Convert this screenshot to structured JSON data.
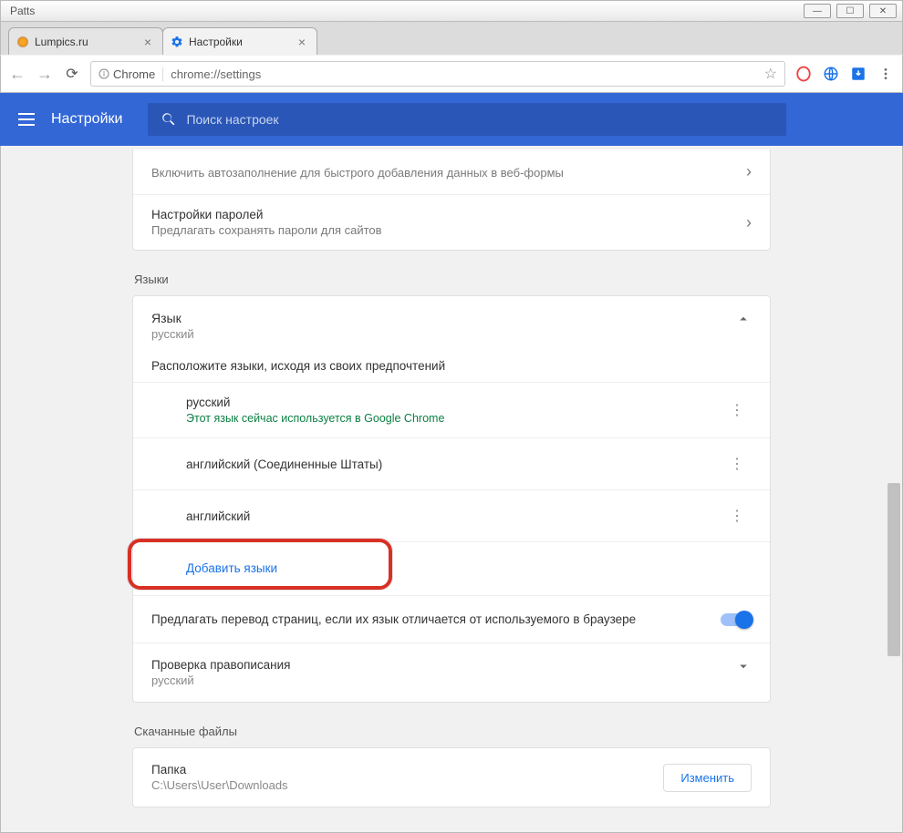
{
  "titlebar": {
    "app": "Patts"
  },
  "tabs": [
    {
      "label": "Lumpics.ru"
    },
    {
      "label": "Настройки"
    }
  ],
  "omnibox": {
    "origin": "Chrome",
    "url": "chrome://settings"
  },
  "header": {
    "title": "Настройки",
    "search_placeholder": "Поиск настроек"
  },
  "top_card": {
    "autofill_sub": "Включить автозаполнение для быстрого добавления данных в веб-формы",
    "passwords_title": "Настройки паролей",
    "passwords_sub": "Предлагать сохранять пароли для сайтов"
  },
  "sections": {
    "languages_label": "Языки",
    "downloads_label": "Скачанные файлы"
  },
  "language": {
    "header_title": "Язык",
    "header_sub": "русский",
    "instruction": "Расположите языки, исходя из своих предпочтений",
    "items": [
      {
        "name": "русский",
        "sub": "Этот язык сейчас используется в Google Chrome"
      },
      {
        "name": "английский (Соединенные Штаты)",
        "sub": ""
      },
      {
        "name": "английский",
        "sub": ""
      }
    ],
    "add_link": "Добавить языки",
    "translate_label": "Предлагать перевод страниц, если их язык отличается от используемого в браузере",
    "spell_title": "Проверка правописания",
    "spell_sub": "русский"
  },
  "downloads": {
    "folder_label": "Папка",
    "folder_path": "C:\\Users\\User\\Downloads",
    "change_btn": "Изменить"
  }
}
